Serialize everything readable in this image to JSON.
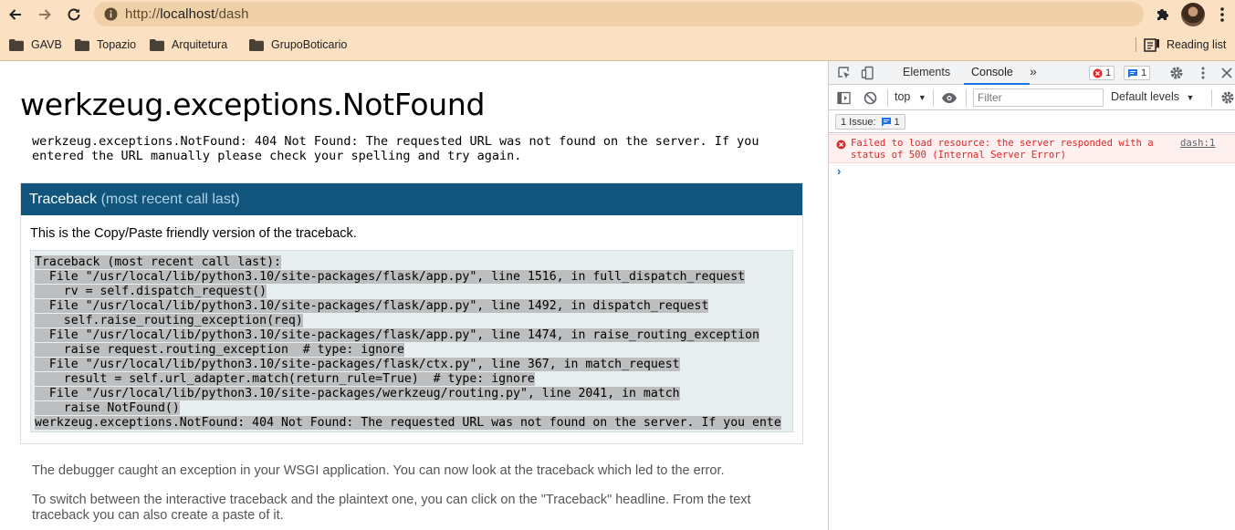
{
  "browser": {
    "url_prefix": "http://",
    "url_host": "localhost",
    "url_path": "/dash",
    "bookmarks": [
      {
        "label": "GAVB"
      },
      {
        "label": "Topazio"
      },
      {
        "label": "Arquitetura"
      },
      {
        "label": "GrupoBoticario"
      }
    ],
    "reading_list": "Reading list",
    "theme_color": "#fbe1c1"
  },
  "page": {
    "title": "werkzeug.exceptions.NotFound",
    "error_message": "werkzeug.exceptions.NotFound: 404 Not Found: The requested URL was not found on the server. If you entered the URL manually please check your spelling and try again.",
    "traceback_title": "Traceback",
    "traceback_subtitle": "(most recent call last)",
    "traceback_intro": "This is the Copy/Paste friendly version of the traceback.",
    "traceback_lines": [
      "Traceback (most recent call last):",
      "  File \"/usr/local/lib/python3.10/site-packages/flask/app.py\", line 1516, in full_dispatch_request",
      "    rv = self.dispatch_request()",
      "  File \"/usr/local/lib/python3.10/site-packages/flask/app.py\", line 1492, in dispatch_request",
      "    self.raise_routing_exception(req)",
      "  File \"/usr/local/lib/python3.10/site-packages/flask/app.py\", line 1474, in raise_routing_exception",
      "    raise request.routing_exception  # type: ignore",
      "  File \"/usr/local/lib/python3.10/site-packages/flask/ctx.py\", line 367, in match_request",
      "    result = self.url_adapter.match(return_rule=True)  # type: ignore",
      "  File \"/usr/local/lib/python3.10/site-packages/werkzeug/routing.py\", line 2041, in match",
      "    raise NotFound()",
      "werkzeug.exceptions.NotFound: 404 Not Found: The requested URL was not found on the server. If you ente"
    ],
    "footer_1": "The debugger caught an exception in your WSGI application. You can now look at the traceback which led to the error.",
    "footer_2": "To switch between the interactive traceback and the plaintext one, you can click on the \"Traceback\" headline. From the text traceback you can also create a paste of it.",
    "header_color": "#11557c"
  },
  "devtools": {
    "tabs": [
      {
        "label": "Elements"
      },
      {
        "label": "Console"
      }
    ],
    "active_tab": "Console",
    "error_count": "1",
    "message_count": "1",
    "context": "top",
    "filter_placeholder": "Filter",
    "levels": "Default levels",
    "issues_label": "1 Issue:",
    "issues_count": "1",
    "error_text": "Failed to load resource: the server responded with a status of 500 (Internal Server Error)",
    "error_source": "dash:1",
    "error_color": "#e02727"
  }
}
